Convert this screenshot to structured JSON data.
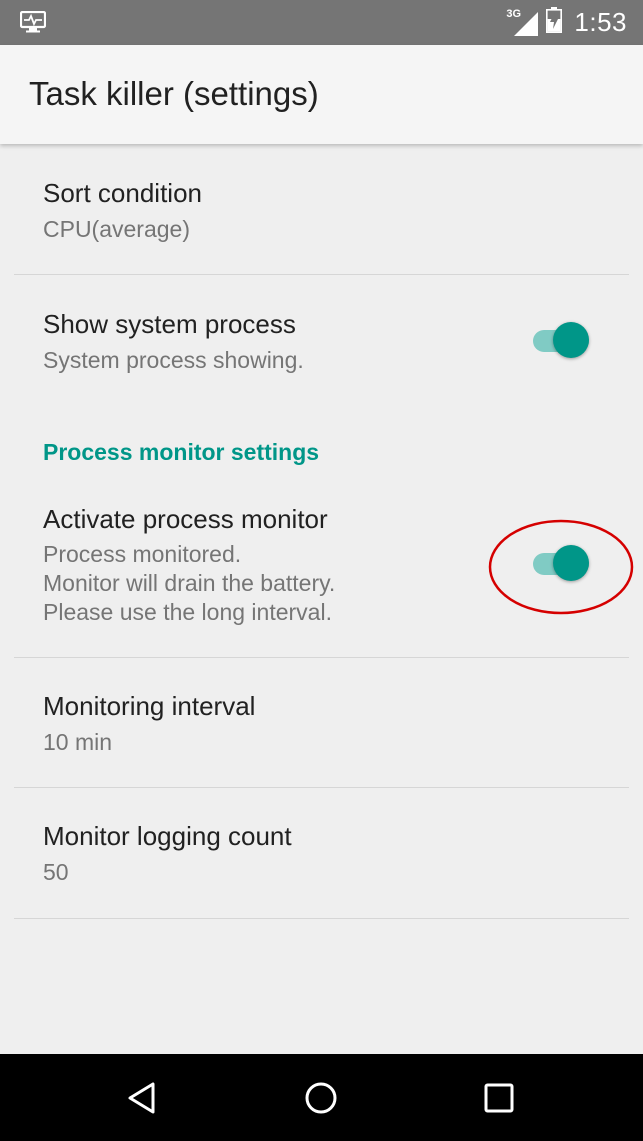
{
  "status_bar": {
    "left_icon": "monitor-pulse-icon",
    "network": "3G",
    "signal_icon": "cell-signal-icon",
    "battery_icon": "battery-charging-icon",
    "time": "1:53"
  },
  "app_bar": {
    "title": "Task killer (settings)"
  },
  "settings": {
    "sort_condition": {
      "title": "Sort condition",
      "summary": "CPU(average)"
    },
    "show_system_process": {
      "title": "Show system process",
      "summary": "System process showing.",
      "enabled": true
    },
    "category": "Process monitor settings",
    "activate_process_monitor": {
      "title": "Activate process monitor",
      "summary_lines": [
        "Process monitored.",
        "Monitor will drain the battery.",
        "Please use the long interval."
      ],
      "enabled": true
    },
    "monitoring_interval": {
      "title": "Monitoring interval",
      "summary": "10 min"
    },
    "monitor_logging_count": {
      "title": "Monitor logging count",
      "summary": "50"
    }
  },
  "nav_bar": {
    "back_icon": "back-triangle-icon",
    "home_icon": "home-circle-icon",
    "recents_icon": "recents-square-icon"
  },
  "colors": {
    "accent": "#009688",
    "accent_light": "#80cbc4",
    "status_bar": "#757575",
    "annotation": "#d50000"
  }
}
